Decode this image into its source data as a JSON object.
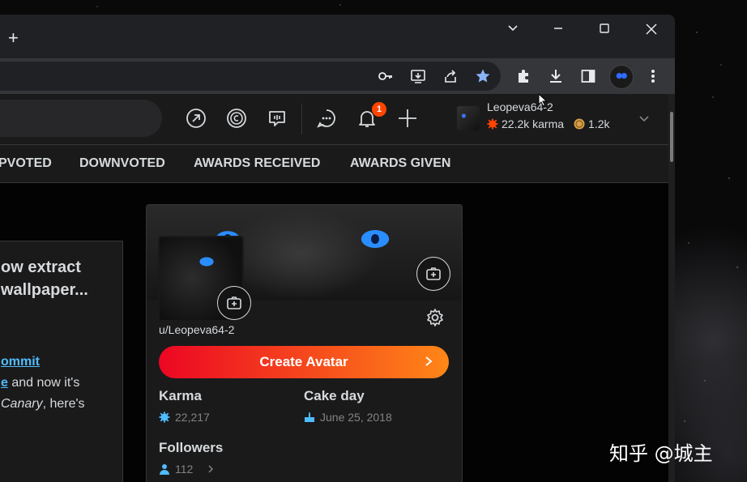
{
  "browser": {
    "new_tab_symbol": "+",
    "window_controls": {
      "dropdown": "⌄",
      "minimize": "—",
      "maximize": "☐",
      "close": "✕"
    },
    "toolbar_icons": [
      "key-icon",
      "install-icon",
      "share-icon",
      "bookmark-star-icon",
      "extensions-icon",
      "download-icon",
      "sidepanel-icon",
      "profile-avatar",
      "menu-icon"
    ]
  },
  "reddit_header": {
    "notification_count": "1",
    "user": {
      "name": "Leopeva64-2",
      "karma": "22.2k karma",
      "coins": "1.2k"
    }
  },
  "profile_tabs": [
    "PVOTED",
    "DOWNVOTED",
    "AWARDS RECEIVED",
    "AWARDS GIVEN"
  ],
  "post": {
    "title_line1": "ow extract",
    "title_line2": "wallpaper...",
    "link_text": "ommit",
    "line2_link": "e",
    "line2_rest": " and now it's",
    "line3_italic": "Canary",
    "line3_rest": ", here's"
  },
  "profile_card": {
    "username": "u/Leopeva64-2",
    "create_avatar": "Create Avatar",
    "karma_label": "Karma",
    "karma_value": "22,217",
    "cakeday_label": "Cake day",
    "cakeday_value": "June 25, 2018",
    "followers_label": "Followers",
    "followers_value": "112"
  },
  "watermark": "知乎 @城主",
  "colors": {
    "accent_blue": "#4fbcff",
    "orange": "#ff4500",
    "gradient_start": "#ec0623",
    "gradient_end": "#ff8717"
  }
}
